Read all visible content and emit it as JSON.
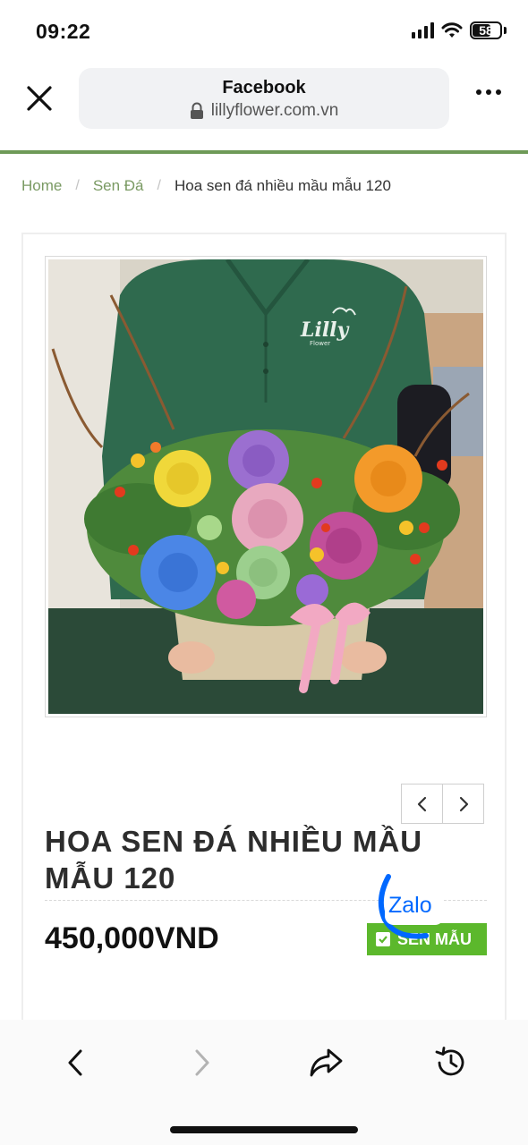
{
  "status_bar": {
    "time": "09:22",
    "battery": "58"
  },
  "browser": {
    "title": "Facebook",
    "url": "lillyflower.com.vn"
  },
  "breadcrumb": {
    "home": "Home",
    "category": "Sen Đá",
    "current": "Hoa sen đá nhiều mầu mẫu 120",
    "separator": "/"
  },
  "product": {
    "title_line1": "HOA SEN ĐÁ NHIỀU MẦU",
    "title_line2": "MẪU 120",
    "price": "450,000VND",
    "sample_button": "SEN MẪU",
    "photo_logo": "Lilly",
    "photo_logo_sub": "Flower"
  },
  "zalo": {
    "label": "Zalo"
  },
  "toolbar": {
    "icons": [
      "back-icon",
      "forward-icon",
      "share-icon",
      "history-icon"
    ]
  },
  "colors": {
    "accent_green": "#6e9a57",
    "button_green": "#5cb82c",
    "zalo_blue": "#0068ff"
  }
}
